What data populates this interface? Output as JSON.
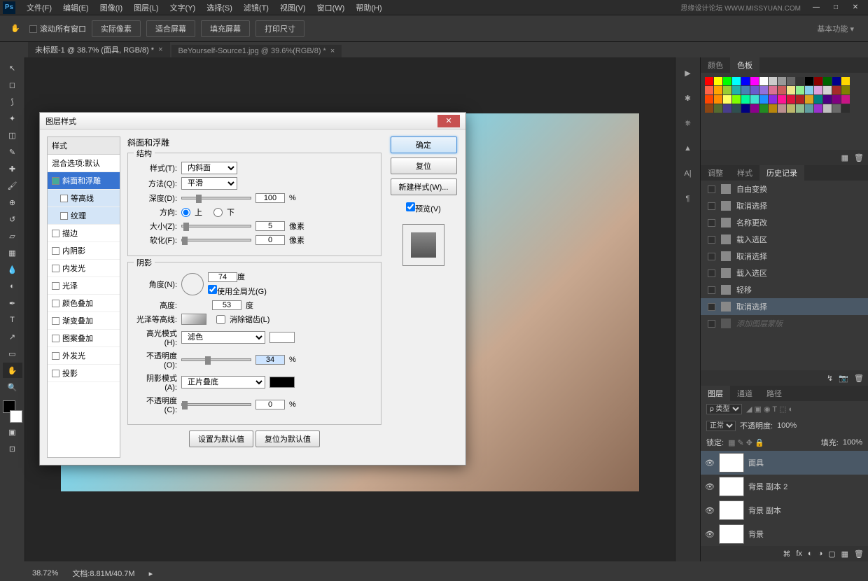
{
  "menu": [
    "文件(F)",
    "编辑(E)",
    "图像(I)",
    "图层(L)",
    "文字(Y)",
    "选择(S)",
    "滤镜(T)",
    "视图(V)",
    "窗口(W)",
    "帮助(H)"
  ],
  "brand": "思缘设计论坛  WWW.MISSYUAN.COM",
  "opt_scroll": "滚动所有窗口",
  "opt_buttons": [
    "实际像素",
    "适合屏幕",
    "填充屏幕",
    "打印尺寸"
  ],
  "essentials": "基本功能",
  "tabs": [
    {
      "label": "未标题-1 @ 38.7% (面具, RGB/8) *",
      "active": true
    },
    {
      "label": "BeYourself-Source1.jpg @ 39.6%(RGB/8) *",
      "active": false
    }
  ],
  "color_tabs": [
    "颜色",
    "色板"
  ],
  "adjust_tabs": [
    "调整",
    "样式",
    "历史记录"
  ],
  "history": [
    "自由变换",
    "取消选择",
    "名称更改",
    "载入选区",
    "取消选择",
    "载入选区",
    "轻移",
    "取消选择"
  ],
  "history_dim": "添加图层蒙版",
  "layer_tabs": [
    "图层",
    "通道",
    "路径"
  ],
  "layer_kind": "ρ 类型",
  "blend_mode": "正常",
  "opacity_label": "不透明度:",
  "opacity_val": "100%",
  "lock_label": "锁定:",
  "fill_label": "填充:",
  "fill_val": "100%",
  "layers": [
    {
      "name": "面具",
      "sel": true
    },
    {
      "name": "背景 副本 2",
      "sel": false
    },
    {
      "name": "背景 副本",
      "sel": false
    },
    {
      "name": "背景",
      "sel": false
    }
  ],
  "zoom": "38.72%",
  "docinfo": "文档:8.81M/40.7M",
  "dialog": {
    "title": "图层样式",
    "styles_header": "样式",
    "styles": [
      {
        "label": "混合选项:默认",
        "cbx": false,
        "sel": false
      },
      {
        "label": "斜面和浮雕",
        "cbx": true,
        "chk": true,
        "sel": true
      },
      {
        "label": "等高线",
        "cbx": true,
        "chk": false,
        "sub": true
      },
      {
        "label": "纹理",
        "cbx": true,
        "chk": false,
        "sub": true
      },
      {
        "label": "描边",
        "cbx": true
      },
      {
        "label": "内阴影",
        "cbx": true
      },
      {
        "label": "内发光",
        "cbx": true
      },
      {
        "label": "光泽",
        "cbx": true
      },
      {
        "label": "颜色叠加",
        "cbx": true
      },
      {
        "label": "渐变叠加",
        "cbx": true
      },
      {
        "label": "图案叠加",
        "cbx": true
      },
      {
        "label": "外发光",
        "cbx": true
      },
      {
        "label": "投影",
        "cbx": true
      }
    ],
    "section_title": "斜面和浮雕",
    "structure_label": "结构",
    "style_lbl": "样式(T):",
    "style_val": "内斜面",
    "method_lbl": "方法(Q):",
    "method_val": "平滑",
    "depth_lbl": "深度(D):",
    "depth_val": "100",
    "depth_unit": "%",
    "direction_lbl": "方向:",
    "dir_up": "上",
    "dir_down": "下",
    "size_lbl": "大小(Z):",
    "size_val": "5",
    "size_unit": "像素",
    "soften_lbl": "软化(F):",
    "soften_val": "0",
    "soften_unit": "像素",
    "shading_label": "阴影",
    "angle_lbl": "角度(N):",
    "angle_val": "74",
    "angle_unit": "度",
    "global_light": "使用全局光(G)",
    "altitude_lbl": "高度:",
    "altitude_val": "53",
    "altitude_unit": "度",
    "gloss_lbl": "光泽等高线:",
    "antialias": "消除锯齿(L)",
    "highlight_lbl": "高光模式(H):",
    "highlight_val": "滤色",
    "opacity1_lbl": "不透明度(O):",
    "opacity1_val": "34",
    "opacity1_unit": "%",
    "shadow_lbl": "阴影模式(A):",
    "shadow_val": "正片叠底",
    "opacity2_lbl": "不透明度(C):",
    "opacity2_val": "0",
    "opacity2_unit": "%",
    "make_default": "设置为默认值",
    "reset_default": "复位为默认值",
    "ok": "确定",
    "cancel": "复位",
    "new_style": "新建样式(W)...",
    "preview": "预览(V)"
  },
  "swatch_colors": [
    "#ff0000",
    "#ffff00",
    "#00ff00",
    "#00ffff",
    "#0000ff",
    "#ff00ff",
    "#ffffff",
    "#cccccc",
    "#999999",
    "#666666",
    "#333333",
    "#000000",
    "#8b0000",
    "#006400",
    "#00008b",
    "#ffd700",
    "#ff6347",
    "#ffa500",
    "#9acd32",
    "#20b2aa",
    "#4682b4",
    "#6a5acd",
    "#9370db",
    "#db7093",
    "#cd5c5c",
    "#f0e68c",
    "#90ee90",
    "#87ceeb",
    "#dda0dd",
    "#d3d3d3",
    "#a52a2a",
    "#808000",
    "#ff4500",
    "#ff8c00",
    "#ffff66",
    "#7fff00",
    "#00fa9a",
    "#40e0d0",
    "#1e90ff",
    "#8a2be2",
    "#ff1493",
    "#dc143c",
    "#b22222",
    "#daa520",
    "#008080",
    "#4b0082",
    "#800080",
    "#c71585",
    "#8b4513",
    "#556b2f",
    "#483d8b",
    "#2f4f4f",
    "#000080",
    "#8b008b",
    "#228b22",
    "#b8860b",
    "#bc8f8f",
    "#bdb76b",
    "#8fbc8f",
    "#5f9ea0",
    "#9932cc",
    "#c0c0c0",
    "#696969",
    "#2e2e2e"
  ]
}
